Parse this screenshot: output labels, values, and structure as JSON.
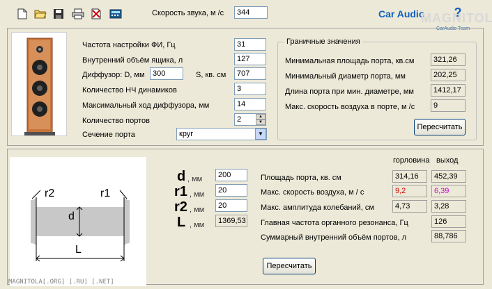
{
  "toolbar": {
    "icons": [
      "new-file-icon",
      "open-folder-icon",
      "save-icon",
      "print-icon",
      "delete-icon",
      "calculator-icon"
    ]
  },
  "sound_speed": {
    "label": "Скорость звука, м /с",
    "value": "344"
  },
  "brand": {
    "text": "Car Audio",
    "help": "?",
    "watermark": "MAGNITOLA",
    "watermark_sub": "CarAudio Team"
  },
  "params": {
    "tuning_freq": {
      "label": "Частота настройки ФИ, Гц",
      "value": "31"
    },
    "box_volume": {
      "label": "Внутренний объём ящика, л",
      "value": "127"
    },
    "diffuser": {
      "label": "Диффузор: D, мм",
      "d_value": "300",
      "s_label": "S, кв. см",
      "s_value": "707"
    },
    "woofer_count": {
      "label": "Количество НЧ динамиков",
      "value": "3"
    },
    "max_excursion": {
      "label": "Максимальный ход диффузора, мм",
      "value": "14"
    },
    "port_count": {
      "label": "Количество портов",
      "value": "2"
    },
    "port_section": {
      "label": "Сечение порта",
      "value": "круг"
    }
  },
  "limits": {
    "title": "Граничные значения",
    "rows": [
      {
        "label": "Минимальная площадь порта, кв.см",
        "value": "321,26"
      },
      {
        "label": "Минимальный диаметр порта, мм",
        "value": "202,25"
      },
      {
        "label": "Длина порта при мин. диаметре, мм",
        "value": "1412,17"
      },
      {
        "label": "Макс. скорость воздуха в порте, м /с",
        "value": "9"
      }
    ],
    "recalc_label": "Пересчитать"
  },
  "port": {
    "drawing": {
      "r2": "r2",
      "r1": "r1",
      "d": "d",
      "L": "L"
    },
    "inputs": [
      {
        "symbol": "d",
        "unit": ", мм",
        "value": "200"
      },
      {
        "symbol": "r1",
        "unit": ", мм",
        "value": "20"
      },
      {
        "symbol": "r2",
        "unit": ", мм",
        "value": "20"
      },
      {
        "symbol": "L",
        "unit": ", мм",
        "value": "1369,53"
      }
    ],
    "col_headers": {
      "throat": "горловина",
      "exit": "выход"
    },
    "results": [
      {
        "label": "Площадь порта, кв. см",
        "throat": "314,16",
        "exit": "452,39"
      },
      {
        "label": "Макс. скорость воздуха, м / с",
        "throat": "9,2",
        "exit": "6,39"
      },
      {
        "label": "Макс. амплитуда колебаний, см",
        "throat": "4,73",
        "exit": "3,28"
      },
      {
        "label": "Главная частота органного резонанса, Гц",
        "throat": "126"
      },
      {
        "label": "Суммарный внутренний объём портов, л",
        "throat": "88,786"
      }
    ],
    "recalc_label": "Пересчитать"
  },
  "footer": {
    "text": "MAGNITOLA[.ORG] [.RU] [.NET]"
  },
  "colors": {
    "throat_speed": "#cc0000",
    "exit_speed": "#cc00cc",
    "brand": "#1060c0"
  }
}
